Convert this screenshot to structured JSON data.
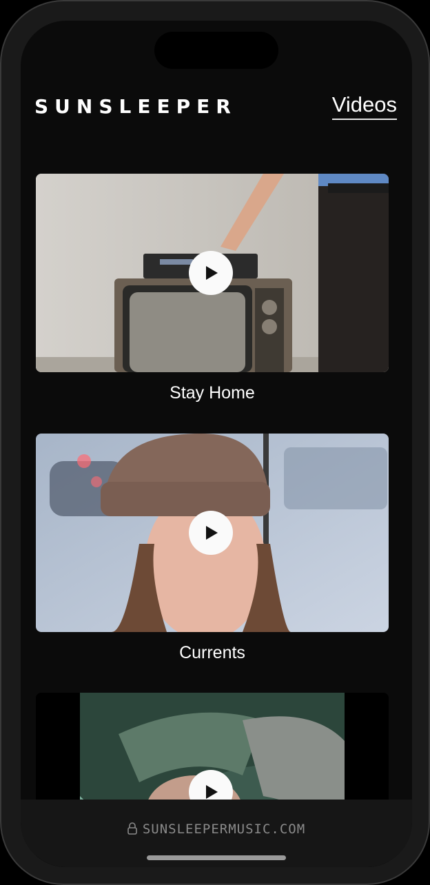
{
  "header": {
    "brand": "SUNSLEEPER",
    "nav_label": "Videos"
  },
  "videos": [
    {
      "title": "Stay Home"
    },
    {
      "title": "Currents"
    },
    {
      "title": ""
    }
  ],
  "footer": {
    "url": "SUNSLEEPERMUSIC.COM"
  },
  "icons": {
    "play": "play-icon",
    "lock": "lock-icon"
  }
}
